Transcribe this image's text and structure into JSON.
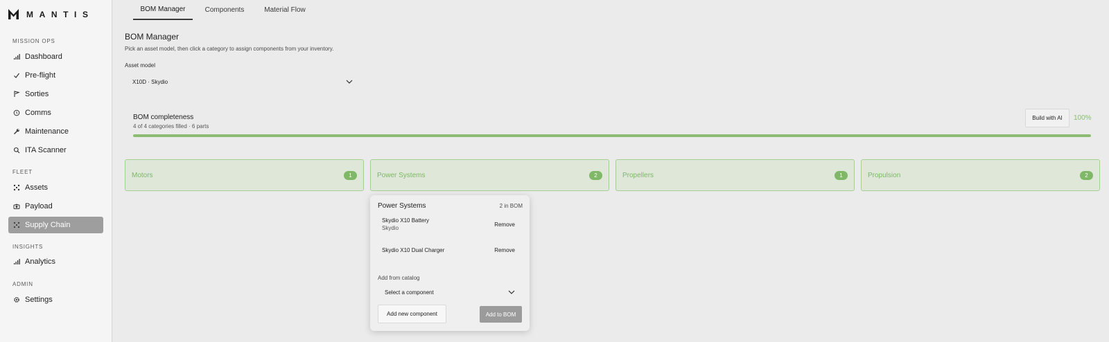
{
  "app": {
    "brand": "MANTIS"
  },
  "sidebar": {
    "sections": [
      {
        "title": "MISSION OPS"
      },
      {
        "title": "FLEET"
      },
      {
        "title": "INSIGHTS"
      },
      {
        "title": "ADMIN"
      }
    ],
    "items": [
      {
        "label": "Dashboard",
        "icon": "bar-chart-icon"
      },
      {
        "label": "Pre-flight",
        "icon": "check-icon"
      },
      {
        "label": "Sorties",
        "icon": "flag-icon"
      },
      {
        "label": "Comms",
        "icon": "clock-icon"
      },
      {
        "label": "Maintenance",
        "icon": "wrench-icon"
      },
      {
        "label": "ITA Scanner",
        "icon": "search-icon"
      },
      {
        "label": "Assets",
        "icon": "drone-icon"
      },
      {
        "label": "Payload",
        "icon": "camera-icon"
      },
      {
        "label": "Supply Chain",
        "icon": "drone-icon",
        "active": true
      },
      {
        "label": "Analytics",
        "icon": "bar-chart-icon"
      },
      {
        "label": "Settings",
        "icon": "gear-icon"
      }
    ]
  },
  "tabs": [
    {
      "label": "BOM Manager",
      "active": true
    },
    {
      "label": "Components"
    },
    {
      "label": "Material Flow"
    }
  ],
  "main": {
    "title": "BOM Manager",
    "subtitle": "Pick an asset model, then click a category to assign components from your inventory.",
    "asset_label": "Asset model",
    "asset_value": "X10D · Skydio"
  },
  "completeness": {
    "title": "BOM completeness",
    "subtitle": "4 of 4 categories filled · 6 parts",
    "build_ai_label": "Build with AI",
    "percent_label": "100%",
    "fraction": 1.0
  },
  "categories": [
    {
      "name": "Motors",
      "count": "1"
    },
    {
      "name": "Power Systems",
      "count": "2"
    },
    {
      "name": "Propellers",
      "count": "1"
    },
    {
      "name": "Propulsion",
      "count": "2"
    }
  ],
  "popover": {
    "title": "Power Systems",
    "count_label": "2 in BOM",
    "items": [
      {
        "name": "Skydio X10 Battery",
        "brand": "Skydio",
        "remove": "Remove"
      },
      {
        "name": "Skydio X10 Dual Charger",
        "remove": "Remove"
      }
    ],
    "add_label": "Add from catalog",
    "select_placeholder": "Select a component",
    "new_button": "Add new component",
    "add_button": "Add to BOM"
  },
  "colors": {
    "accent_green": "#7fb866",
    "active_nav": "#9e9e9e"
  }
}
